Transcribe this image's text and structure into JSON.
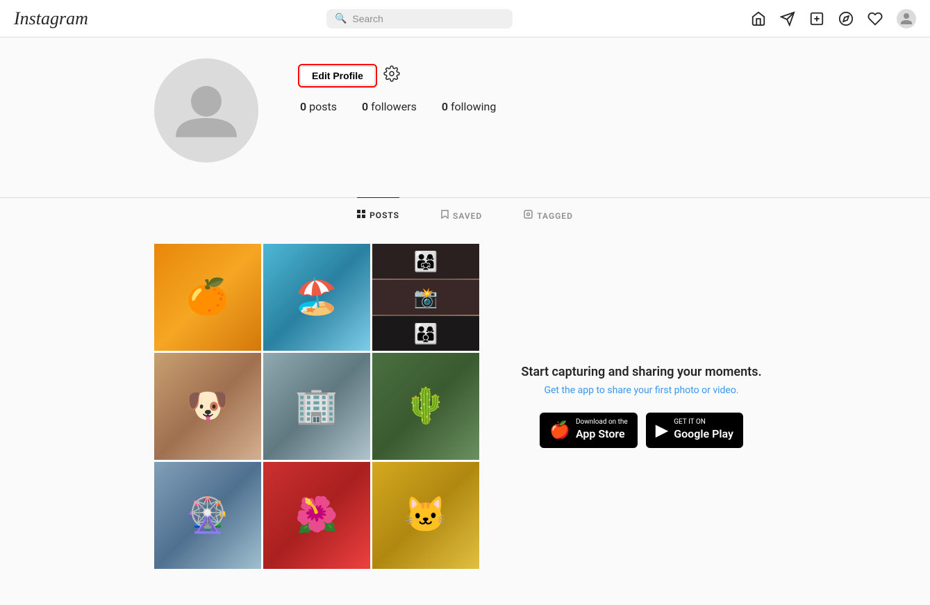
{
  "header": {
    "logo": "Instagram",
    "search_placeholder": "Search",
    "nav_icons": {
      "home": "⌂",
      "send": "▷",
      "add": "⊕",
      "explore": "◎",
      "heart": "♡"
    }
  },
  "profile": {
    "edit_profile_label": "Edit Profile",
    "stats": {
      "posts_count": "0",
      "posts_label": "posts",
      "followers_count": "0",
      "followers_label": "followers",
      "following_count": "0",
      "following_label": "following"
    }
  },
  "tabs": {
    "posts_label": "POSTS",
    "saved_label": "SAVED",
    "tagged_label": "TAGGED"
  },
  "promo": {
    "title": "Start capturing and sharing your moments.",
    "subtitle": "Get the app to share your first photo or video.",
    "app_store_small": "Download on the",
    "app_store_large": "App Store",
    "google_play_small": "GET IT ON",
    "google_play_large": "Google Play"
  }
}
